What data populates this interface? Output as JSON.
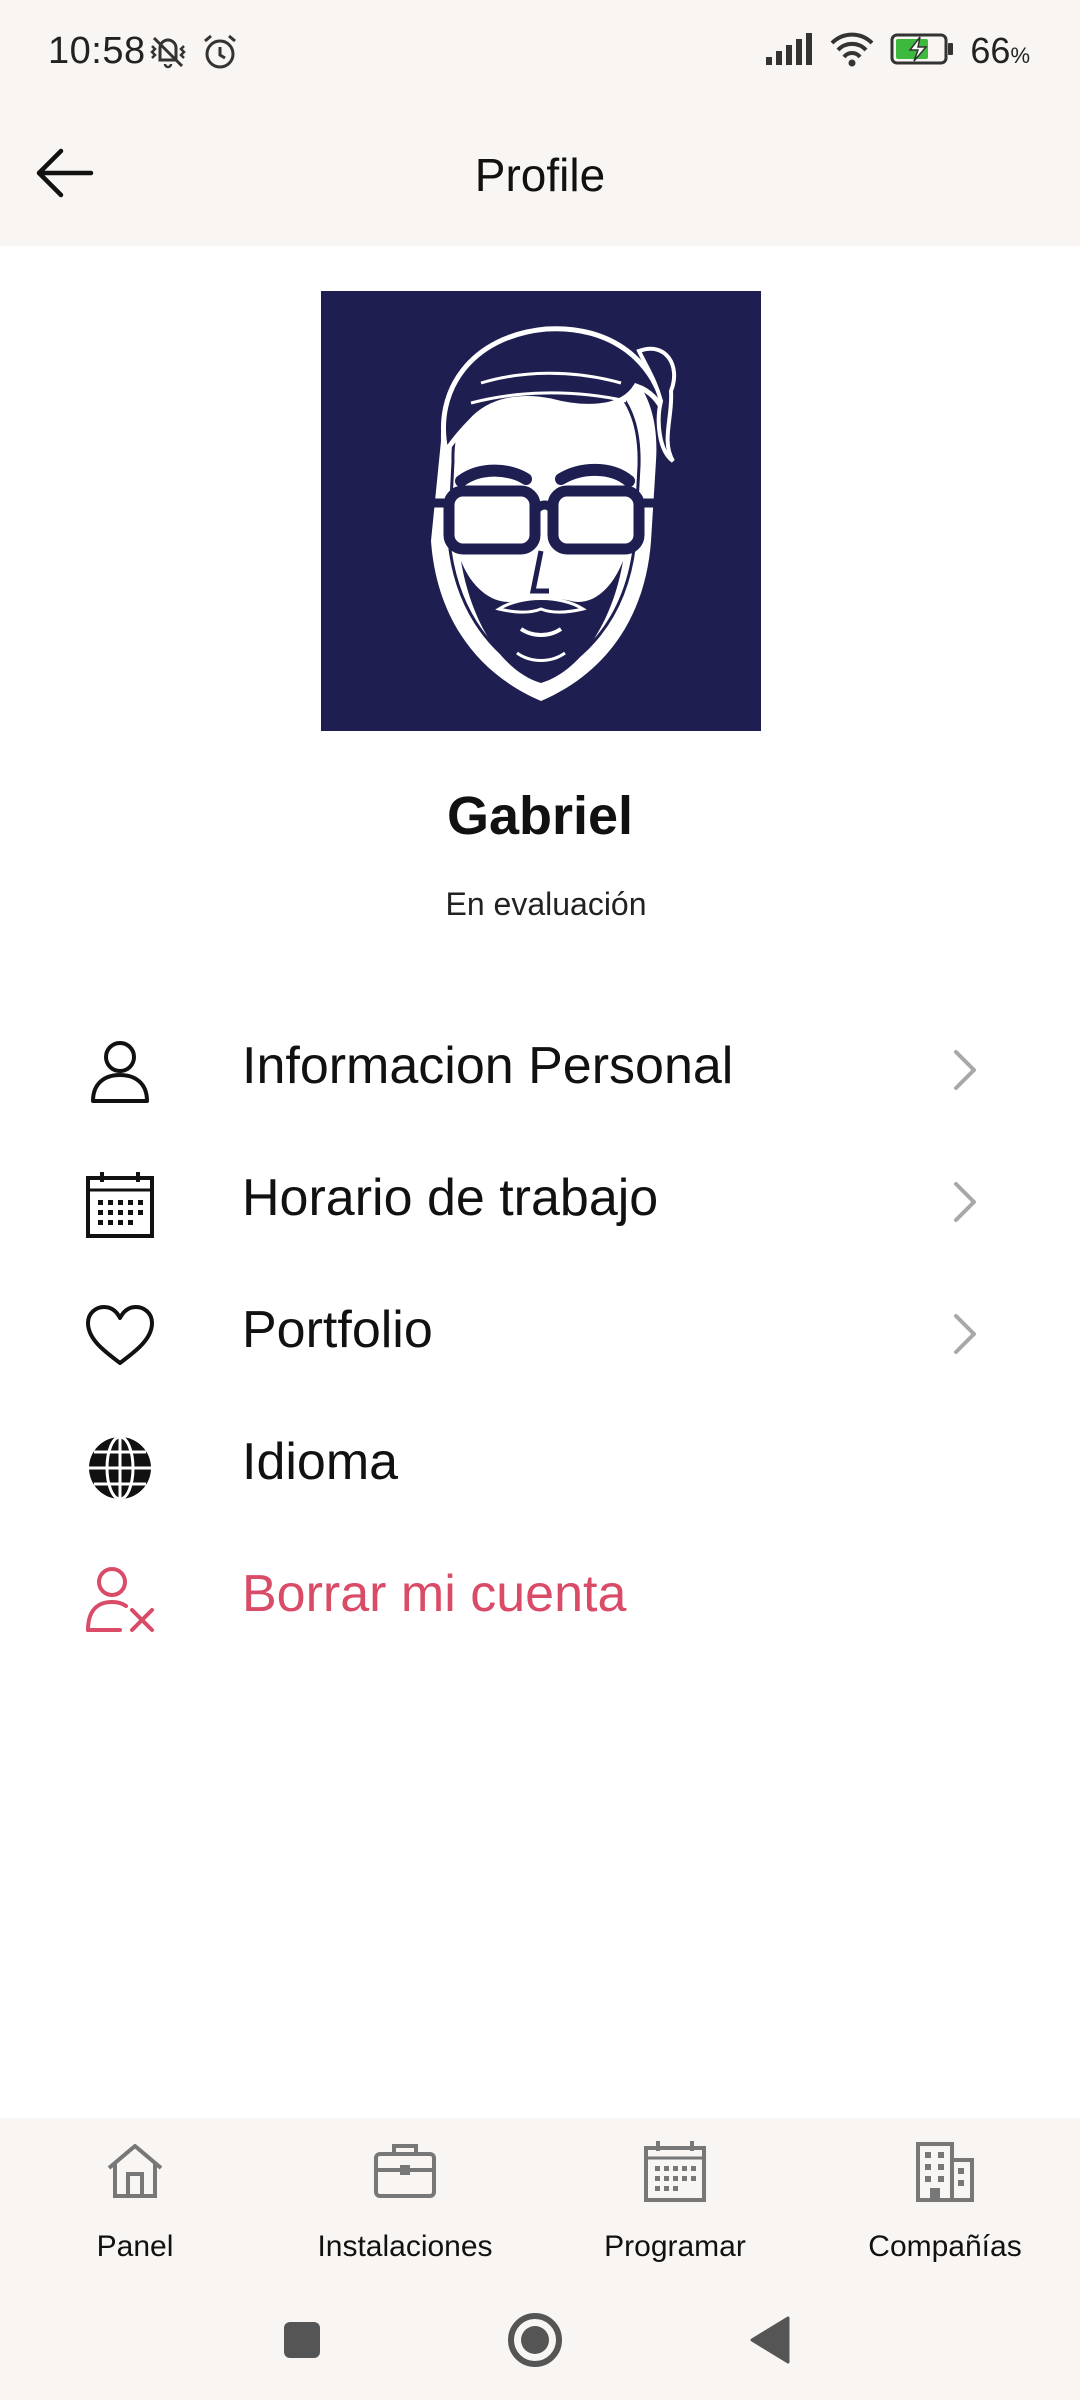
{
  "status_bar": {
    "time": "10:58",
    "battery_percent": "66",
    "battery_unit": "%",
    "icons_left": [
      "vibrate-off-icon",
      "alarm-icon"
    ],
    "icons_right": [
      "signal-icon",
      "wifi-icon",
      "battery-charging-icon"
    ]
  },
  "app_bar": {
    "title": "Profile",
    "back_icon": "arrow-left-icon"
  },
  "profile": {
    "name": "Gabriel",
    "status": "En evaluación",
    "avatar_background": "#1f1e50"
  },
  "menu": {
    "items": [
      {
        "label": "Informacion Personal",
        "icon": "person-icon",
        "has_chevron": true
      },
      {
        "label": "Horario de trabajo",
        "icon": "calendar-icon",
        "has_chevron": true
      },
      {
        "label": "Portfolio",
        "icon": "heart-icon",
        "has_chevron": true
      },
      {
        "label": "Idioma",
        "icon": "globe-icon",
        "has_chevron": false
      },
      {
        "label": "Borrar mi cuenta",
        "icon": "remove-user-icon",
        "has_chevron": false,
        "color": "#d94b66"
      }
    ]
  },
  "bottom_nav": {
    "items": [
      {
        "label": "Panel",
        "icon": "home-icon"
      },
      {
        "label": "Instalaciones",
        "icon": "briefcase-icon"
      },
      {
        "label": "Programar",
        "icon": "calendar-icon"
      },
      {
        "label": "Compañías",
        "icon": "building-icon"
      }
    ]
  },
  "colors": {
    "bar_background": "#f8f5f2",
    "danger": "#d94b66",
    "chevron": "#a8a8a8"
  }
}
